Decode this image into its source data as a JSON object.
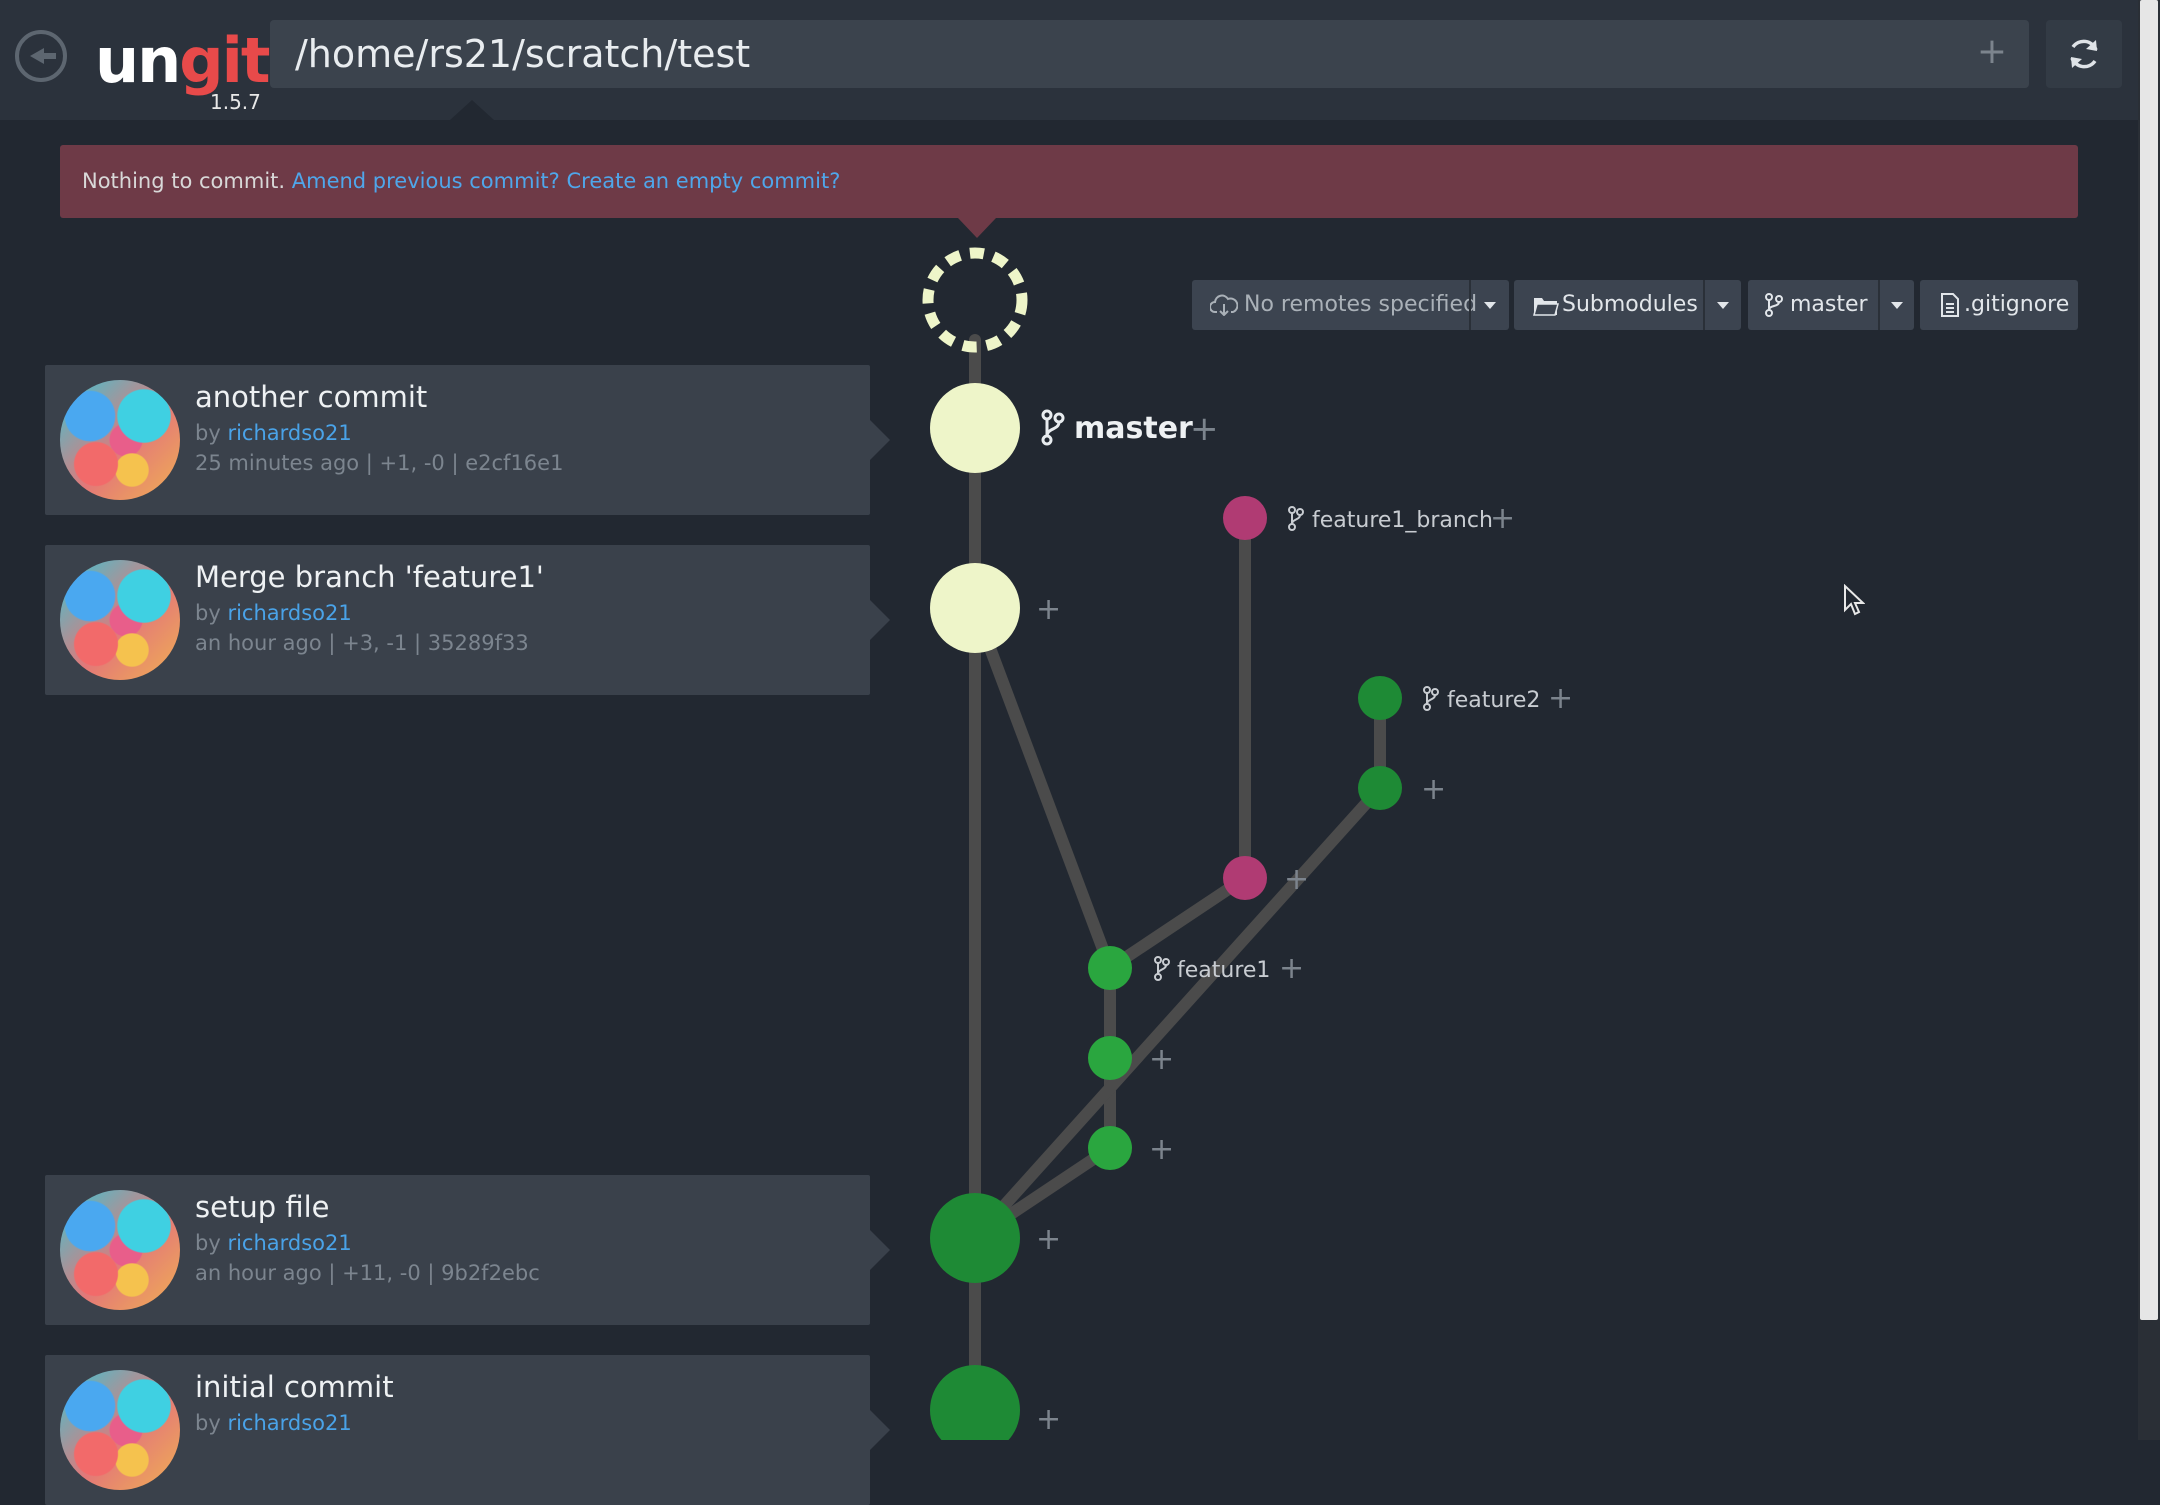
{
  "app": {
    "logo_un": "un",
    "logo_git": "git",
    "version": "1.5.7",
    "path": "/home/rs21/scratch/test"
  },
  "alert": {
    "text": "Nothing to commit.",
    "amend_link": "Amend previous commit?",
    "empty_link": "Create an empty commit?"
  },
  "toolbar": {
    "remotes_label": "No remotes specified",
    "submodules_label": "Submodules",
    "branch_label": "master",
    "gitignore_label": ".gitignore"
  },
  "commits": [
    {
      "title": "another commit",
      "by": "by",
      "author": "richardso21",
      "meta": "25 minutes ago | +1, -0 | e2cf16e1"
    },
    {
      "title": "Merge branch 'feature1'",
      "by": "by",
      "author": "richardso21",
      "meta": "an hour ago | +3, -1 | 35289f33"
    },
    {
      "title": "setup file",
      "by": "by",
      "author": "richardso21",
      "meta": "an hour ago | +11, -0 | 9b2f2ebc"
    },
    {
      "title": "initial commit",
      "by": "by",
      "author": "richardso21",
      "meta": ""
    }
  ],
  "branches": {
    "master": "master",
    "feature1_branch": "feature1_branch",
    "feature2": "feature2",
    "feature1": "feature1"
  },
  "colors": {
    "master_node": "#eef5c9",
    "feature_node": "#1e8a35",
    "feature1_node": "#2aa63f",
    "branch_node": "#b03b73",
    "edge": "#4b4b4b",
    "alert_bg": "#6e3a47",
    "link": "#4fa6ea"
  }
}
